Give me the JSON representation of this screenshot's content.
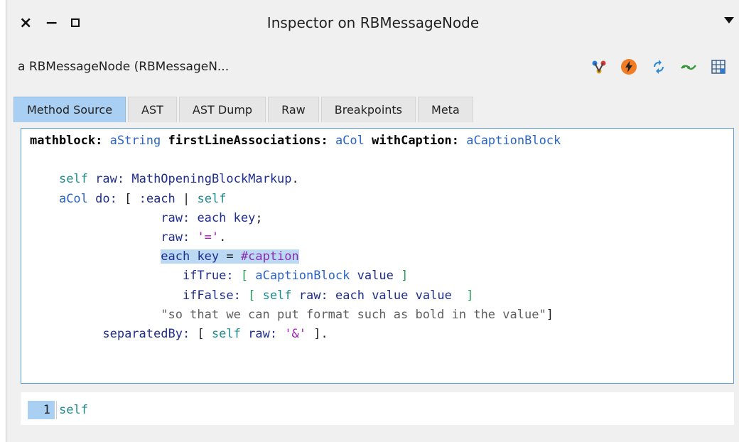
{
  "window": {
    "title": "Inspector on RBMessageNode",
    "controls": {
      "close": "×",
      "minimize": "−"
    }
  },
  "inspector": {
    "subtitle": "a RBMessageNode (RBMessageN...",
    "toolbar_icons": [
      "browse-icon",
      "flash-icon",
      "refresh-icon",
      "pinned-icon",
      "spreadsheet-icon"
    ]
  },
  "tabs": [
    "Method Source",
    "AST",
    "AST Dump",
    "Raw",
    "Breakpoints",
    "Meta"
  ],
  "active_tab": "Method Source",
  "code": {
    "selector_1": "mathblock:",
    "arg_1": "aString",
    "selector_2": "firstLineAssociations:",
    "arg_2": "aCol",
    "selector_3": "withCaption:",
    "arg_3": "aCaptionBlock",
    "self": "self",
    "raw_kw": "raw:",
    "global": "MathOpeningBlockMarkup",
    "do_kw": "do:",
    "each_param": ":each",
    "each": "each",
    "key": "key",
    "eq_str": "'='",
    "caption_sym": "#caption",
    "iftrue": "ifTrue:",
    "iffalse": "ifFalse:",
    "value": "value",
    "comment": "\"so that we can put format such as bold in the value\"",
    "separated": "separatedBy:",
    "amp_str": "'&'"
  },
  "eval_pane": {
    "line_number": "1",
    "text": "self"
  },
  "colors": {
    "accent": "#a9cff3",
    "focus_border": "#5aa0df",
    "selection": "#bcd9f4"
  }
}
